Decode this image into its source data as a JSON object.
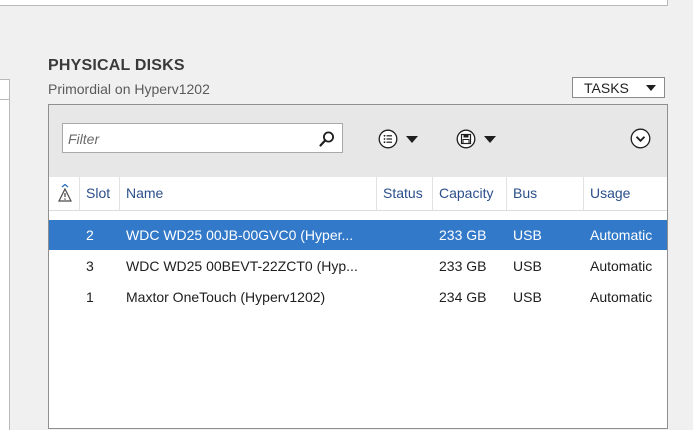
{
  "section": {
    "title": "PHYSICAL DISKS",
    "subtitle": "Primordial on Hyperv1202",
    "tasks_label": "TASKS"
  },
  "toolbar": {
    "filter_placeholder": "Filter"
  },
  "icons": {
    "filter_search": "search-icon",
    "view_list": "list-icon",
    "save": "save-icon",
    "expand": "chevron-down-icon",
    "sort_warning": "warning-icon"
  },
  "table": {
    "columns": [
      "Slot",
      "Name",
      "Status",
      "Capacity",
      "Bus",
      "Usage"
    ],
    "rows": [
      {
        "slot": "2",
        "name": "WDC WD25 00JB-00GVC0 (Hyper...",
        "status": "",
        "capacity": "233 GB",
        "bus": "USB",
        "usage": "Automatic",
        "selected": true
      },
      {
        "slot": "3",
        "name": "WDC WD25 00BEVT-22ZCT0 (Hyp...",
        "status": "",
        "capacity": "233 GB",
        "bus": "USB",
        "usage": "Automatic",
        "selected": false
      },
      {
        "slot": "1",
        "name": "Maxtor OneTouch (Hyperv1202)",
        "status": "",
        "capacity": "234 GB",
        "bus": "USB",
        "usage": "Automatic",
        "selected": false
      }
    ]
  },
  "colors": {
    "selection": "#3279c9",
    "header_text": "#2a4f8a",
    "toolbar_bg": "#e7e7e7"
  }
}
